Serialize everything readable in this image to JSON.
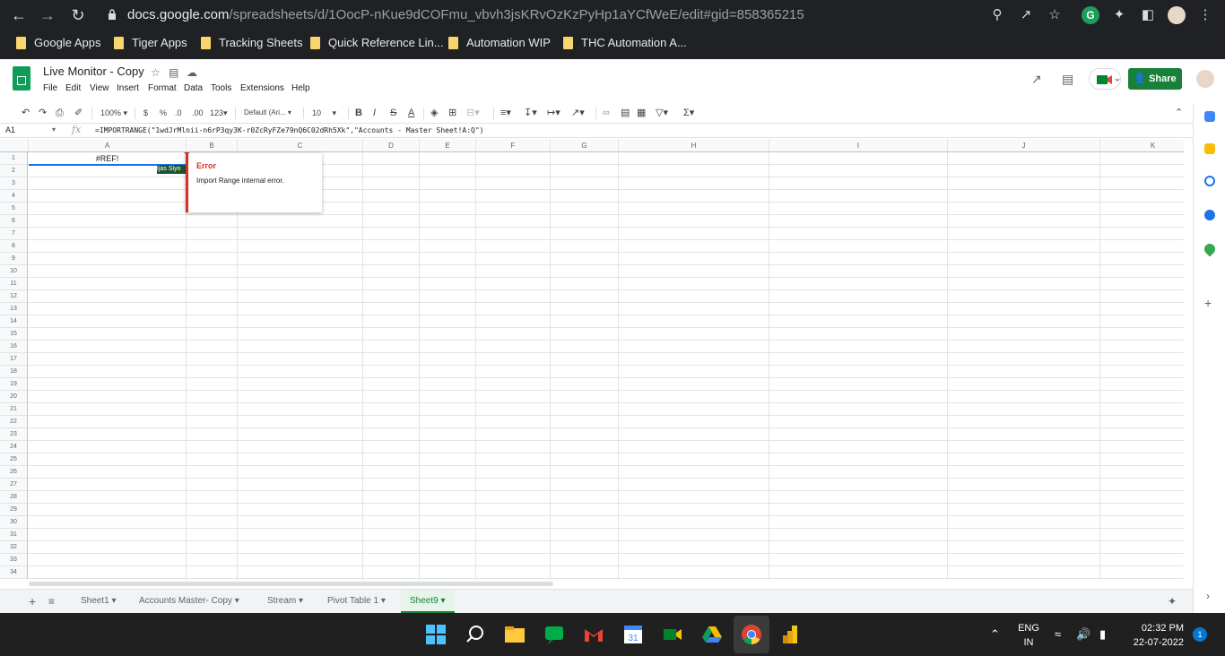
{
  "browser": {
    "url_domain": "docs.google.com",
    "url_path": "/spreadsheets/d/1OocP-nKue9dCOFmu_vbvh3jsKRvOzKzPyHp1aYCfWeE/edit#gid=858365215",
    "bookmarks": [
      "Google Apps",
      "Tiger Apps",
      "Tracking Sheets",
      "Quick Reference Lin...",
      "Automation WIP",
      "THC Automation A..."
    ]
  },
  "doc": {
    "title": "Live Monitor - Copy",
    "menus": [
      "File",
      "Edit",
      "View",
      "Insert",
      "Format",
      "Data",
      "Tools",
      "Extensions",
      "Help"
    ],
    "share_label": "Share"
  },
  "toolbar": {
    "zoom": "100%",
    "currency": "$",
    "percent": "%",
    "dec_less": ".0",
    "dec_more": ".00",
    "format_123": "123",
    "font": "Default (Ari...",
    "font_size": "10"
  },
  "formula_bar": {
    "cell_ref": "A1",
    "fx": "fx",
    "formula": "=IMPORTRANGE(\"1wdJrMlnii-n6rP3qy3K-r0ZcRyFZe79nQ6C02dRh5Xk\",\"Accounts - Master Sheet!A:Q\")"
  },
  "grid": {
    "columns": [
      "A",
      "B",
      "C",
      "D",
      "E",
      "F",
      "G",
      "H",
      "I",
      "J",
      "K"
    ],
    "rows": [
      "1",
      "2",
      "3",
      "4",
      "5",
      "6",
      "7",
      "8",
      "9",
      "10",
      "11",
      "12",
      "13",
      "14",
      "15",
      "16",
      "17",
      "18",
      "19",
      "20",
      "21",
      "22",
      "23",
      "24",
      "25",
      "26",
      "27",
      "28",
      "29",
      "30",
      "31",
      "32",
      "33",
      "34"
    ],
    "a1_value": "#REF!",
    "a2_value": "Ijas Siyo"
  },
  "error_popup": {
    "title": "Error",
    "message": "Import Range internal error."
  },
  "sheets": {
    "add": "+",
    "tabs": [
      "Sheet1",
      "Accounts Master- Copy",
      "Stream",
      "Pivot Table 1",
      "Sheet9"
    ],
    "active": "Sheet9"
  },
  "taskbar": {
    "lang_top": "ENG",
    "lang_bottom": "IN",
    "time": "02:32 PM",
    "date": "22-07-2022",
    "notifications": "1"
  },
  "colors": {
    "share_green": "#188038",
    "error_red": "#d93025",
    "sheets_green": "#0f9d58"
  }
}
